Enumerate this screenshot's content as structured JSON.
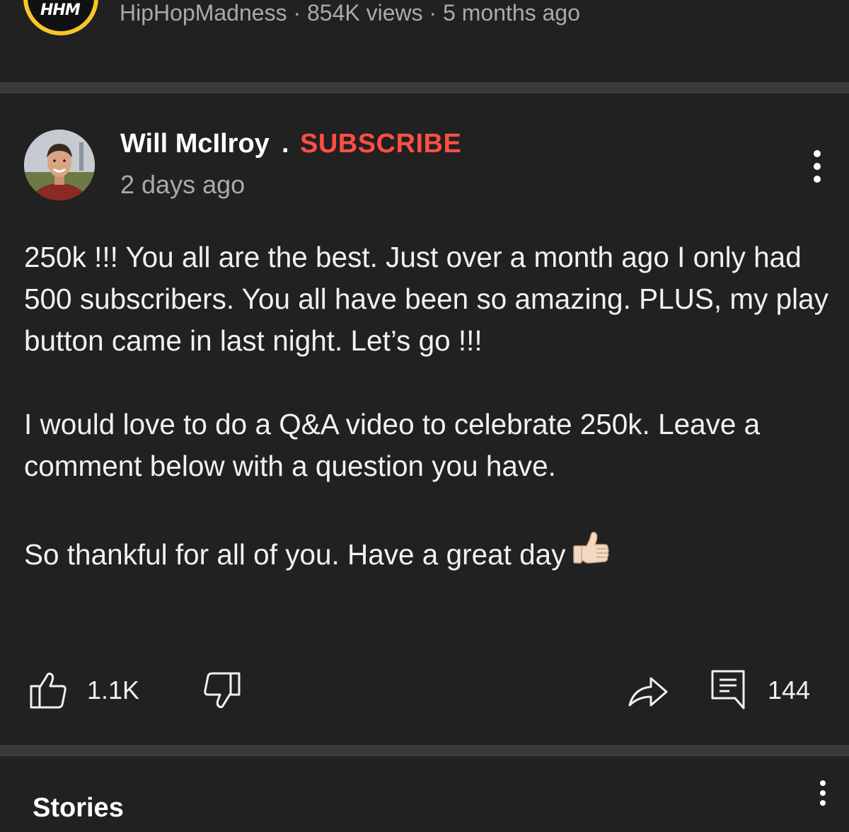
{
  "previous_video": {
    "channel_logo_text": "HHM",
    "channel": "HipHopMadness",
    "separator": "·",
    "views": "854K views",
    "age": "5 months ago"
  },
  "post": {
    "author": "Will McIlroy",
    "name_separator": ".",
    "subscribe_label": "SUBSCRIBE",
    "timestamp": "2 days ago",
    "paragraphs": [
      "250k !!! You all are the best. Just over a month ago I only had 500 subscribers. You all have been so amazing. PLUS, my play button came in last night. Let’s go !!!",
      "I would love to do a Q&A video to celebrate 250k. Leave a comment below with a question you have.",
      "So thankful for all of you. Have a great day"
    ],
    "trailing_emoji": "thumbs-up-light-skin-tone",
    "like_count": "1.1K",
    "comment_count": "144"
  },
  "stories": {
    "title": "Stories"
  },
  "colors": {
    "background": "#212121",
    "divider": "#3a3a3a",
    "subscribe_red": "#ff4e45",
    "secondary_text": "#aaaaaa"
  }
}
